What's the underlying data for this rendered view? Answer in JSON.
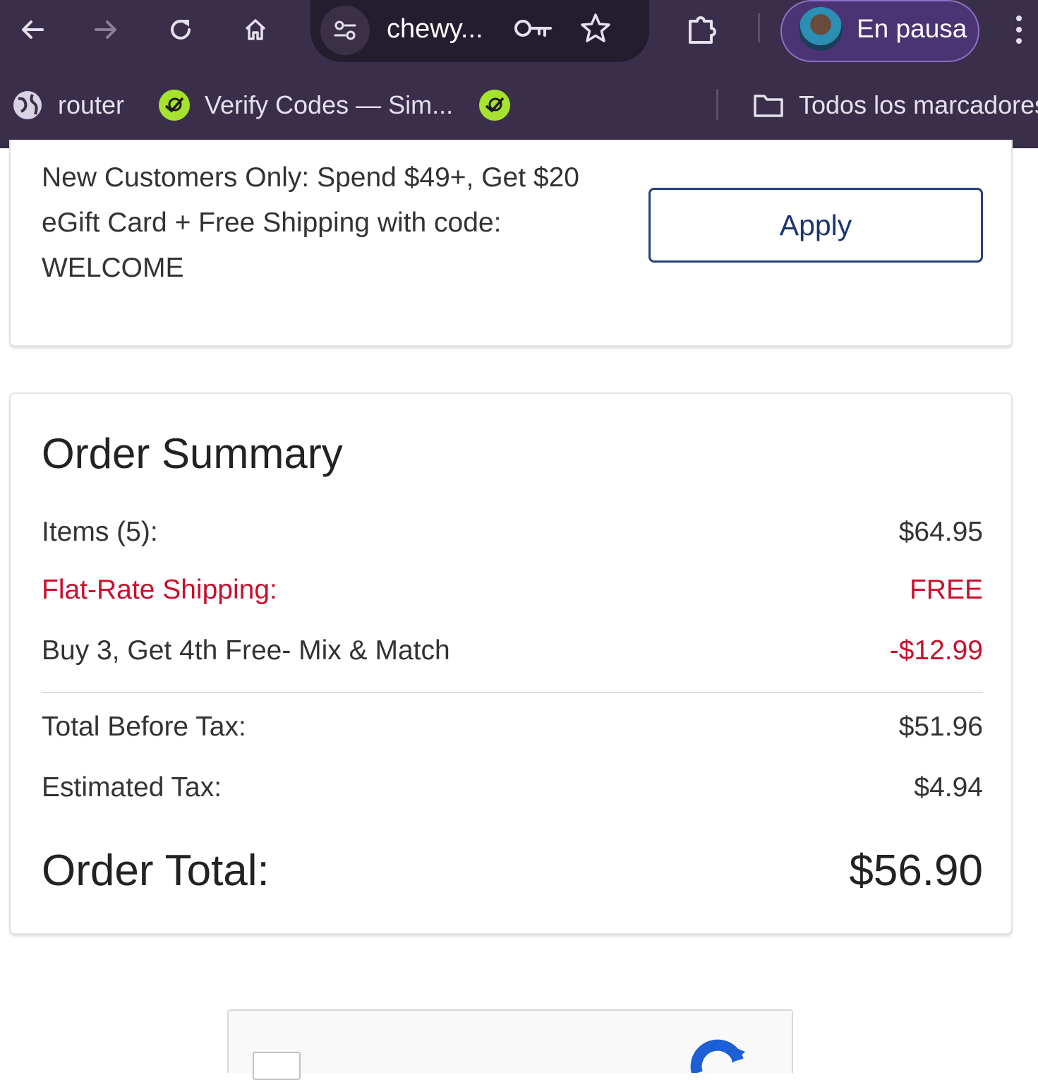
{
  "browser": {
    "url_display": "chewy...",
    "profile_label": "En pausa",
    "bookmarks": [
      {
        "label": "router",
        "icon": "globe-icon"
      },
      {
        "label": "Verify Codes — Sim...",
        "icon": "green-badge-icon"
      },
      {
        "label": "",
        "icon": "green-badge-icon"
      }
    ],
    "all_bookmarks_label": "Todos los marcadores"
  },
  "promo": {
    "line1": "New Customers Only: Spend $49+, Get $20",
    "line2": "eGift Card + Free Shipping with code:",
    "line3": "WELCOME",
    "apply_label": "Apply"
  },
  "summary": {
    "title": "Order Summary",
    "items_label": "Items (5):",
    "items_value": "$64.95",
    "shipping_label": "Flat-Rate Shipping:",
    "shipping_value": "FREE",
    "promo_label": "Buy 3, Get 4th Free- Mix & Match",
    "promo_value": "-$12.99",
    "before_tax_label": "Total Before Tax:",
    "before_tax_value": "$51.96",
    "tax_label": "Estimated Tax:",
    "tax_value": "$4.94",
    "total_label": "Order Total:",
    "total_value": "$56.90"
  },
  "colors": {
    "chrome_bg": "#3a2f4b",
    "accent_red": "#c8102e",
    "button_border": "#24407a",
    "badge_green": "#a6e22e"
  }
}
